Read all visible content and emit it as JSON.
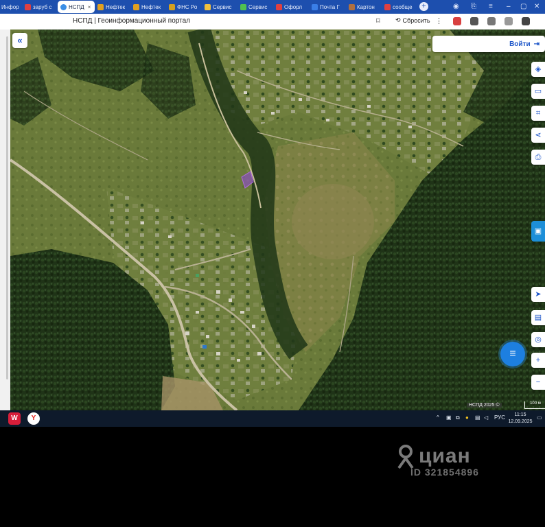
{
  "browser": {
    "tabs": [
      {
        "label": "Инфор",
        "color": "#f0a030"
      },
      {
        "label": "заруб с",
        "color": "#e04040"
      },
      {
        "label": "НСПД",
        "color": "#3a8ee6",
        "active": true
      },
      {
        "label": "Нефтек",
        "color": "#e0a020"
      },
      {
        "label": "Нефтек",
        "color": "#e0a020"
      },
      {
        "label": "ФНС Ро",
        "color": "#d4a020"
      },
      {
        "label": "Сервис",
        "color": "#f0c040"
      },
      {
        "label": "Сервис",
        "color": "#50c050"
      },
      {
        "label": "Офорл",
        "color": "#e04040"
      },
      {
        "label": "Почта Г",
        "color": "#3a7ee6"
      },
      {
        "label": "Картон",
        "color": "#b07040"
      },
      {
        "label": "сообще",
        "color": "#e04040"
      }
    ],
    "close_glyph": "×",
    "new_tab_glyph": "+",
    "page_title": "НСПД | Геоинформационный портал",
    "reset_label": "Сбросить"
  },
  "map": {
    "collapse_icon": "«",
    "login_label": "Войти",
    "login_icon": "⇥",
    "right_tools": [
      "layers-icon",
      "ruler-icon",
      "area-select-icon",
      "share-icon",
      "print-icon",
      "legend-icon",
      "locate-icon",
      "basemap-icon",
      "geolocation-icon",
      "zoom-in-icon",
      "zoom-out-icon"
    ],
    "zoom_in": "+",
    "zoom_out": "−",
    "copyright": "НСПД 2025 ©",
    "scale_label": "100 м"
  },
  "taskbar": {
    "language": "РУС",
    "time": "11:15",
    "date": "12.09.2025"
  },
  "watermark": {
    "brand": "циан",
    "id_text": "ID 321854896"
  }
}
